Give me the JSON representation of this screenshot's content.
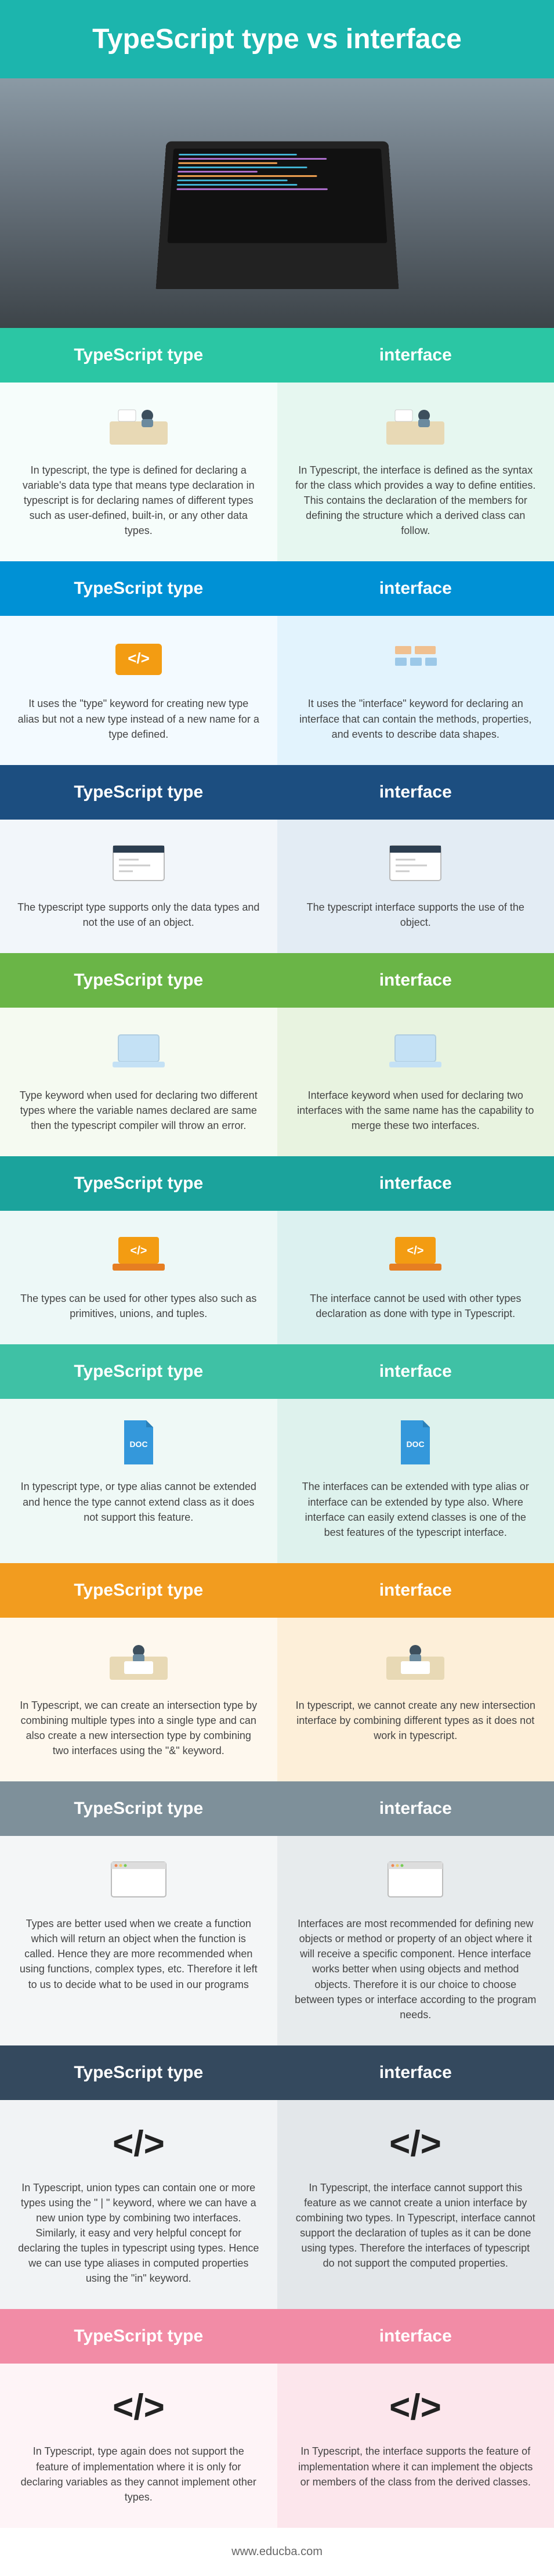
{
  "title": "TypeScript type vs interface",
  "colLeft": "TypeScript type",
  "colRight": "interface",
  "footer": "www.educba.com",
  "rows": [
    {
      "l": "In typescript, the type is defined for declaring a variable's data type that means type declaration in typescript is for declaring names of different types such as user-defined, built-in, or any other data types.",
      "r": "In Typescript, the interface is defined as the syntax for the class which provides a way to define entities. This contains the declaration of the members for defining the structure which a derived class can follow."
    },
    {
      "l": "It uses the \"type\" keyword for creating new type alias but not a new type instead of a new name for a type defined.",
      "r": "It uses the \"interface\" keyword for declaring an interface that can contain the methods, properties, and events to describe data shapes."
    },
    {
      "l": "The typescript type supports only the data types and not the use of an object.",
      "r": "The typescript interface supports the use of the object."
    },
    {
      "l": "Type keyword when used for declaring two different types where the variable names declared are same then the typescript compiler will throw an error.",
      "r": "Interface keyword when used for declaring two interfaces with the same name has the capability to merge these two interfaces."
    },
    {
      "l": "The types can be used for other types also such as primitives, unions, and tuples.",
      "r": "The interface cannot be used with other types declaration as done with type in Typescript."
    },
    {
      "l": "In typescript type, or type alias cannot be extended and hence the type cannot extend class as it does not support this feature.",
      "r": "The interfaces can be extended with type alias or interface can be extended by type also. Where interface can easily extend classes is one of the best features of the typescript interface."
    },
    {
      "l": "In Typescript, we can create an intersection type by combining multiple types into a single type and can also create a new intersection type by combining two interfaces using the \"&\" keyword.",
      "r": "In typescript, we cannot create any new intersection interface by combining different types as it does not work in typescript."
    },
    {
      "l": "Types are better used when we create a function which will return an object when the function is called. Hence they are more recommended when using functions, complex types, etc. Therefore it left to us to decide what to be used in our programs",
      "r": "Interfaces are most recommended for defining new objects or method or property of an object where it will receive a specific component. Hence interface works better when using objects and method objects. Therefore it is our choice to choose between types or interface according to the program needs."
    },
    {
      "l": "In Typescript, union types can contain one or more types using the \" | \" keyword, where we can have a new union type by combining two interfaces. Similarly, it easy and very helpful concept for declaring the tuples in typescript using types. Hence we can use type aliases in computed properties using the \"in\" keyword.",
      "r": "In Typescript, the interface cannot support this feature as we cannot create a union interface by combining two types. In Typescript, interface cannot support the declaration of tuples as it can be done using types. Therefore the interfaces of typescript do not support the computed properties."
    },
    {
      "l": "In Typescript, type again does not support the feature of implementation where it is only for declaring variables as they cannot implement other types.",
      "r": "In Typescript, the interface supports the feature of implementation where it can implement the objects or members of the class from the derived classes."
    }
  ]
}
